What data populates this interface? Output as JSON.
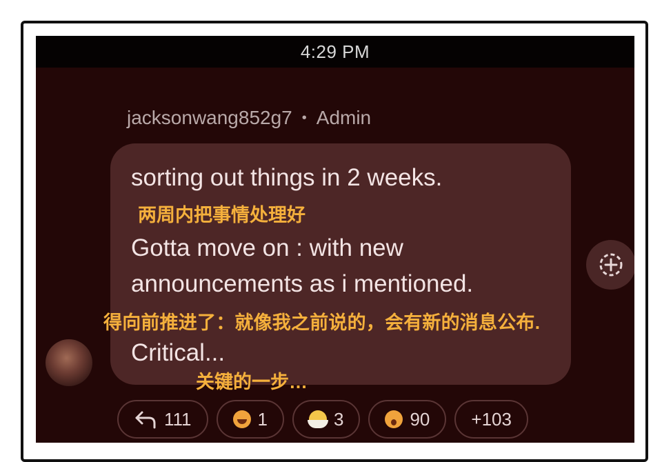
{
  "status_bar": {
    "time": "4:29 PM"
  },
  "post": {
    "author": "jacksonwang852g7",
    "separator": "•",
    "role": "Admin",
    "lines": [
      "sorting out things in 2 weeks.",
      "Gotta move on : with new",
      "announcements as i mentioned.",
      "Critical..."
    ],
    "translations": [
      "两周内把事情处理好",
      "得向前推进了：就像我之前说的，会有新的消息公布.",
      "关键的一步…"
    ]
  },
  "reactions": [
    {
      "icon": "reply-arrow-icon",
      "count": "111"
    },
    {
      "icon": "laughing-face-icon",
      "count": "1"
    },
    {
      "icon": "hatching-chick-icon",
      "count": "3"
    },
    {
      "icon": "surprised-face-icon",
      "count": "90"
    },
    {
      "icon": "",
      "count": "+103"
    }
  ],
  "add_reaction_icon": "add-reaction-icon",
  "colors": {
    "screen_bg": "#230707",
    "bubble_bg": "#4d2626",
    "translation_text": "#f5b03c"
  }
}
